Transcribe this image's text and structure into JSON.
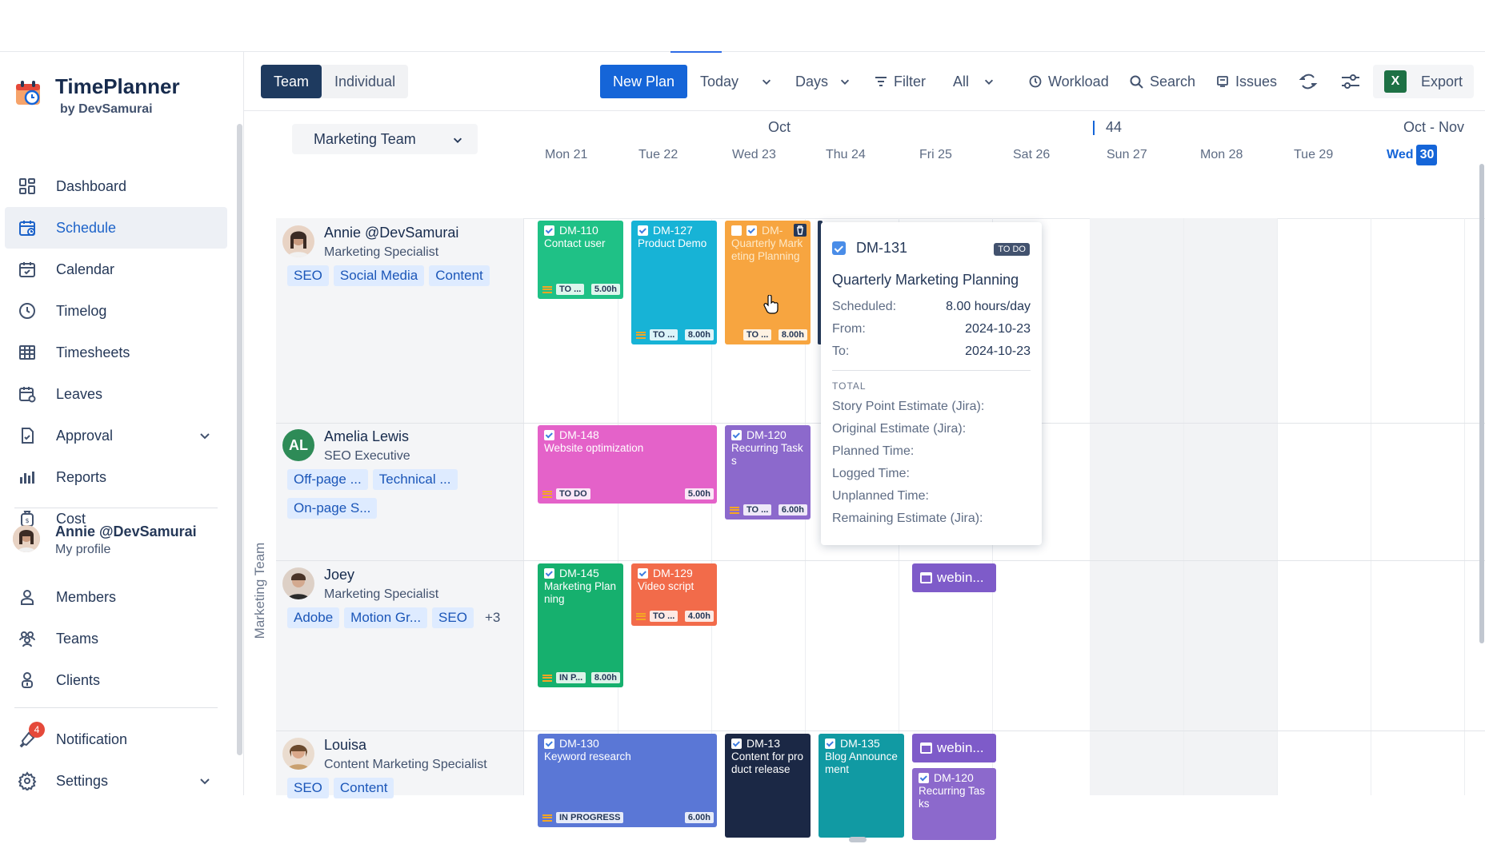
{
  "app": {
    "title": "TimePlanner",
    "subtitle": "by DevSamurai"
  },
  "sidebar": {
    "items": [
      {
        "label": "Dashboard",
        "icon": "dashboard-icon"
      },
      {
        "label": "Schedule",
        "icon": "schedule-icon",
        "active": true
      },
      {
        "label": "Calendar",
        "icon": "calendar-icon"
      },
      {
        "label": "Timelog",
        "icon": "clock-icon"
      },
      {
        "label": "Timesheets",
        "icon": "table-icon"
      },
      {
        "label": "Leaves",
        "icon": "leave-icon"
      },
      {
        "label": "Approval",
        "icon": "approval-icon",
        "expandable": true
      },
      {
        "label": "Reports",
        "icon": "reports-icon"
      },
      {
        "label": "Cost",
        "icon": "cost-icon"
      }
    ],
    "profile": {
      "name": "Annie @DevSamurai",
      "sub": "My profile"
    },
    "bottom_items": [
      {
        "label": "Members",
        "icon": "members-icon"
      },
      {
        "label": "Teams",
        "icon": "teams-icon"
      },
      {
        "label": "Clients",
        "icon": "clients-icon"
      }
    ],
    "notification": {
      "label": "Notification",
      "count": "4"
    },
    "settings": {
      "label": "Settings"
    }
  },
  "toolbar": {
    "view_team": "Team",
    "view_individual": "Individual",
    "new_plan": "New Plan",
    "today": "Today",
    "days": "Days",
    "filter": "Filter",
    "all": "All",
    "workload": "Workload",
    "search": "Search",
    "issues": "Issues",
    "export": "Export"
  },
  "schedule": {
    "team_select": "Marketing Team",
    "team_label": "Marketing Team",
    "month_left": "Oct",
    "week_number": "44",
    "month_right": "Oct - Nov",
    "days": [
      "Mon 21",
      "Tue 22",
      "Wed 23",
      "Thu 24",
      "Fri 25",
      "Sat 26",
      "Sun 27",
      "Mon 28",
      "Tue 29"
    ],
    "today_day": "Wed",
    "today_num": "30",
    "members": [
      {
        "name": "Annie @DevSamurai",
        "role": "Marketing Specialist",
        "tags": [
          "SEO",
          "Social Media",
          "Content"
        ]
      },
      {
        "name": "Amelia Lewis",
        "initials": "AL",
        "role": "SEO Executive",
        "tags": [
          "Off-page ...",
          "Technical ...",
          "On-page S..."
        ]
      },
      {
        "name": "Joey",
        "role": "Marketing Specialist",
        "tags": [
          "Adobe",
          "Motion Gr...",
          "SEO"
        ],
        "more": "+3"
      },
      {
        "name": "Louisa",
        "role": "Content Marketing Specialist",
        "tags": [
          "SEO",
          "Content"
        ]
      }
    ],
    "cards": [
      {
        "id": "DM-110",
        "title": "Contact user",
        "status": "TO ...",
        "hours": "5.00h",
        "color": "#1fc186"
      },
      {
        "id": "DM-127",
        "title": "Product Demo",
        "status": "TO ...",
        "hours": "8.00h",
        "color": "#17b3d6"
      },
      {
        "id": "DM-",
        "title": "Quarterly Marketing Planning",
        "status": "TO ...",
        "hours": "8.00h",
        "color": "#f7a540"
      },
      {
        "id": "DM-148",
        "title": "Website optimization",
        "status": "TO DO",
        "hours": "5.00h",
        "color": "#e462c9"
      },
      {
        "id": "DM-120",
        "title": "Recurring Tasks",
        "status": "TO ...",
        "hours": "6.00h",
        "color": "#8c69cc"
      },
      {
        "id": "DM-145",
        "title": "Marketing Planning",
        "status": "IN P...",
        "hours": "8.00h",
        "color": "#16b06e"
      },
      {
        "id": "DM-129",
        "title": "Video script",
        "status": "TO ...",
        "hours": "4.00h",
        "color": "#f26b4a"
      },
      {
        "id": "DM-130",
        "title": "Keyword research",
        "status": "IN PROGRESS",
        "hours": "6.00h",
        "color": "#5a77d6"
      },
      {
        "id": "DM-13",
        "title": "Content for product release",
        "status": "",
        "hours": "",
        "color": "#1b2845"
      },
      {
        "id": "DM-135",
        "title": "Blog Announcement",
        "status": "",
        "hours": "",
        "color": "#119aa3"
      },
      {
        "id": "DM-120",
        "title": "Recurring Tasks",
        "status": "",
        "hours": "",
        "color": "#8c69cc"
      }
    ],
    "webinars": [
      "webin...",
      "webin..."
    ]
  },
  "popup": {
    "id": "DM-131",
    "badge": "TO DO",
    "title": "Quarterly Marketing Planning",
    "scheduled_label": "Scheduled:",
    "scheduled": "8.00 hours/day",
    "from_label": "From:",
    "from": "2024-10-23",
    "to_label": "To:",
    "to": "2024-10-23",
    "total_label": "TOTAL",
    "items": [
      "Story Point Estimate (Jira):",
      "Original Estimate (Jira):",
      "Planned Time:",
      "Logged Time:",
      "Unplanned Time:",
      "Remaining Estimate (Jira):"
    ]
  }
}
